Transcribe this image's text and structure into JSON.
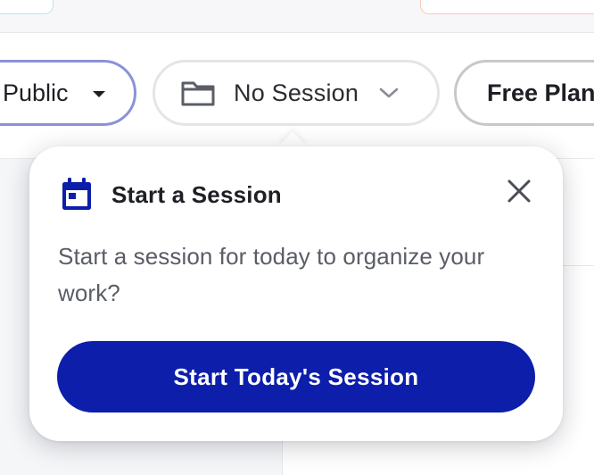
{
  "toolbar": {
    "visibility_label": "Public",
    "session_label": "No Session",
    "plan_label": "Free Plan"
  },
  "popover": {
    "title": "Start a Session",
    "body": "Start a session for today to organize your work?",
    "primary_button": "Start Today's Session"
  },
  "icons": {
    "visibility_caret": "caret-down-icon",
    "session_folder": "folder-icon",
    "session_chevron": "chevron-down-icon",
    "popover_calendar": "calendar-icon",
    "popover_close": "close-icon"
  },
  "colors": {
    "accent": "#0c1eaa",
    "visibility_border": "#8a92d8",
    "session_border": "#e4e5e8",
    "plan_border": "#c7c8cc"
  }
}
